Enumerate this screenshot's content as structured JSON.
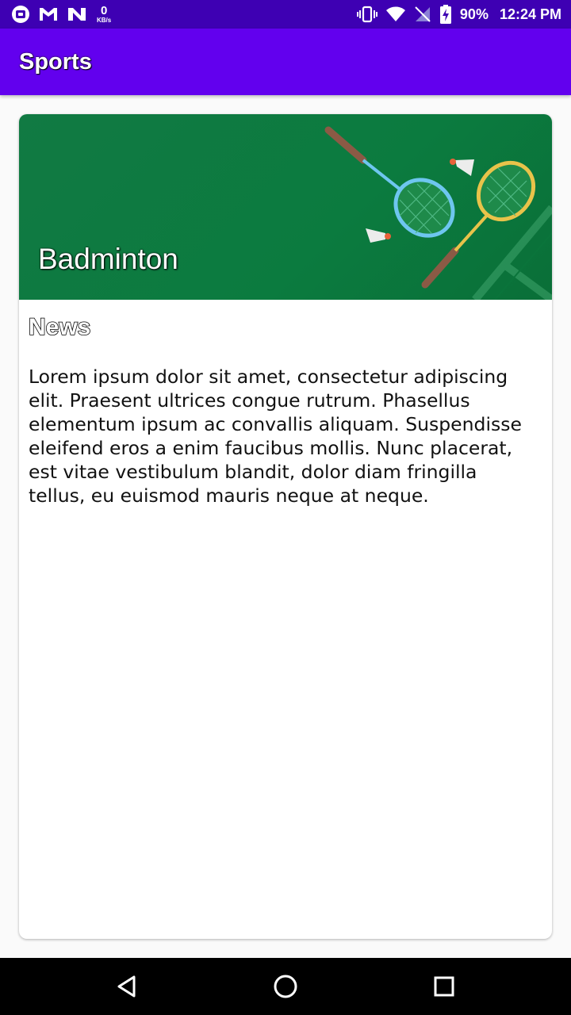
{
  "status_bar": {
    "net_speed_value": "0",
    "net_speed_unit": "KB/s",
    "battery_percent": "90%",
    "time": "12:24 PM",
    "left_icons": [
      "app-notification-icon",
      "gmail-icon",
      "n-app-icon"
    ],
    "right_icons": [
      "vibrate-icon",
      "wifi-icon",
      "no-sim-icon",
      "battery-charging-icon"
    ]
  },
  "app_bar": {
    "title": "Sports",
    "color": "#6200ee"
  },
  "card": {
    "banner_title": "Badminton",
    "banner_color": "#0b7b3f",
    "section_title": "News",
    "body": "Lorem ipsum dolor sit amet, consectetur adipiscing elit. Praesent ultrices congue rutrum. Phasellus elementum ipsum ac convallis aliquam. Suspendisse eleifend eros a enim faucibus mollis. Nunc placerat, est vitae vestibulum blandit, dolor diam fringilla tellus, eu euismod mauris neque at neque."
  },
  "nav_bar": {
    "icons": [
      "back-icon",
      "home-icon",
      "recents-icon"
    ]
  }
}
